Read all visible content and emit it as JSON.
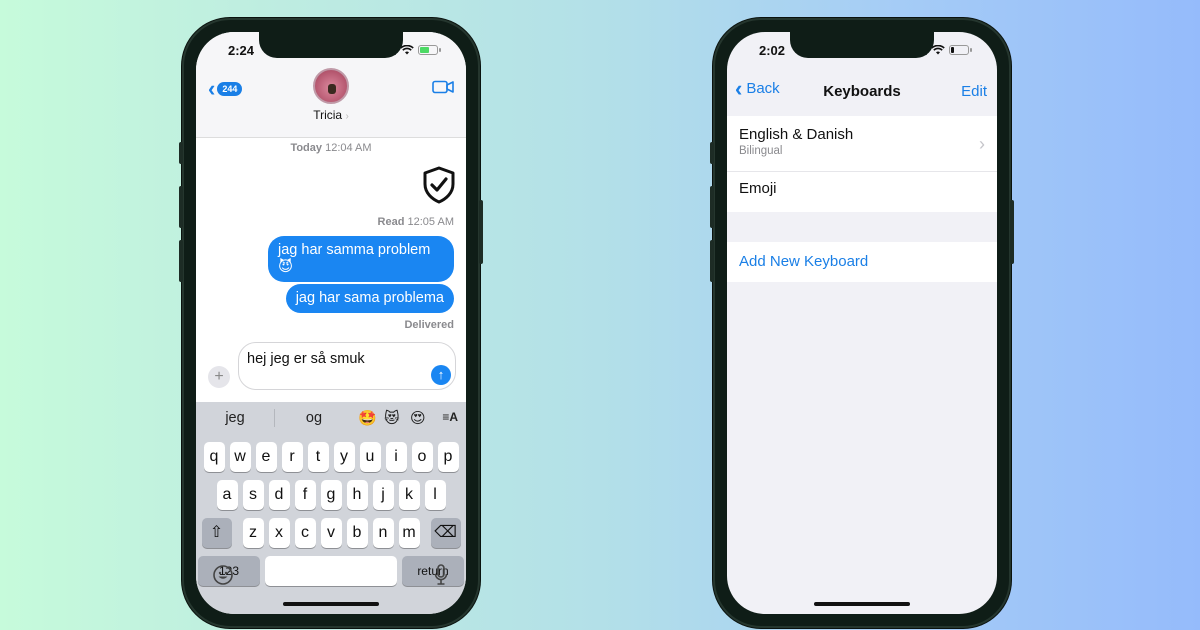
{
  "left_phone": {
    "status": {
      "time": "2:24",
      "battery_state": "charging",
      "battery_color": "#4cd964"
    },
    "header": {
      "back_badge": "244",
      "contact_name": "Tricia",
      "contact_chevron": "›",
      "back_icon": "chevron-left",
      "video_icon": "video-camera"
    },
    "conversation": {
      "timestamp_day": "Today",
      "timestamp_time": "12:04 AM",
      "attachment_icon": "shield-check",
      "read_label": "Read",
      "read_time": "12:05 AM",
      "messages": [
        {
          "text": "jag har samma problem",
          "emoji": "😈"
        },
        {
          "text": "jag har sama problema"
        }
      ],
      "delivered_label": "Delivered"
    },
    "composer": {
      "plus_label": "+",
      "text": "hej jeg er så smuk",
      "send_glyph": "↑"
    },
    "keyboard": {
      "predictions": [
        "jeg",
        "og"
      ],
      "emoji_suggestions": [
        "🤩",
        "😻",
        "😍"
      ],
      "format_glyph": "≡A",
      "row1": [
        "q",
        "w",
        "e",
        "r",
        "t",
        "y",
        "u",
        "i",
        "o",
        "p"
      ],
      "row2": [
        "a",
        "s",
        "d",
        "f",
        "g",
        "h",
        "j",
        "k",
        "l"
      ],
      "row3": [
        "z",
        "x",
        "c",
        "v",
        "b",
        "n",
        "m"
      ],
      "shift_glyph": "⇧",
      "delete_glyph": "⌫",
      "numbers_label": "123",
      "space_label": "",
      "return_label": "return"
    }
  },
  "right_phone": {
    "status": {
      "time": "2:02",
      "battery_state": "low"
    },
    "nav": {
      "back_label": "Back",
      "title": "Keyboards",
      "edit_label": "Edit"
    },
    "keyboards": [
      {
        "name": "English & Danish",
        "subtitle": "Bilingual",
        "has_chevron": true
      },
      {
        "name": "Emoji"
      }
    ],
    "add_keyboard_label": "Add New Keyboard"
  },
  "colors": {
    "ios_blue": "#1a7fe6",
    "bubble_blue": "#1a86f2",
    "background_left": "#c6fbdb",
    "background_right": "#95bbfb"
  }
}
